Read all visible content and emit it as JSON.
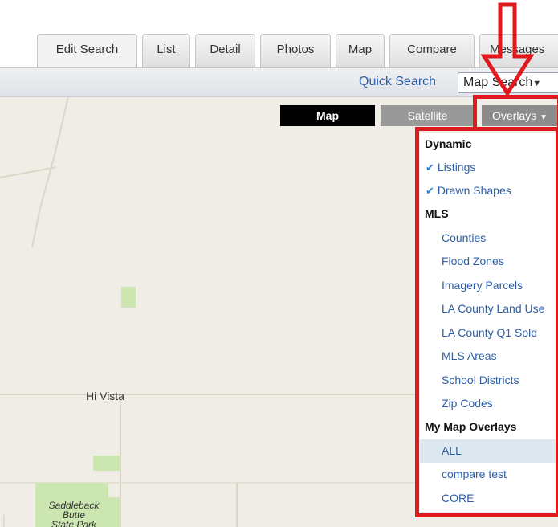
{
  "tabs": [
    {
      "label": "Edit Search",
      "active": true
    },
    {
      "label": "List",
      "active": false
    },
    {
      "label": "Detail",
      "active": false
    },
    {
      "label": "Photos",
      "active": false
    },
    {
      "label": "Map",
      "active": false
    },
    {
      "label": "Compare",
      "active": false
    },
    {
      "label": "Messages",
      "active": false
    }
  ],
  "toolbar": {
    "quick_search": "Quick Search",
    "search_select_value": "Map Search"
  },
  "map": {
    "place_label": "Hi Vista",
    "park_label_line1": "Saddleback",
    "park_label_line2": "Butte",
    "park_label_line3": "State Park",
    "type_buttons": {
      "map": "Map",
      "satellite": "Satellite",
      "overlays": "Overlays"
    }
  },
  "overlays_menu": {
    "dynamic_header": "Dynamic",
    "dynamic_items": [
      "Listings",
      "Drawn Shapes"
    ],
    "mls_header": "MLS",
    "mls_items": [
      "Counties",
      "Flood Zones",
      "Imagery Parcels",
      "LA County Land Use",
      "LA County Q1 Sold",
      "MLS Areas",
      "School Districts",
      "Zip Codes"
    ],
    "my_header": "My Map Overlays",
    "my_items": [
      "ALL",
      "compare test",
      "CORE"
    ]
  },
  "colors": {
    "annotation": "#e0191f",
    "link_blue": "#2b5fa8",
    "check_blue": "#2f7fd8",
    "map_bg": "#f0ede6",
    "park_green": "#cbe6b0"
  }
}
